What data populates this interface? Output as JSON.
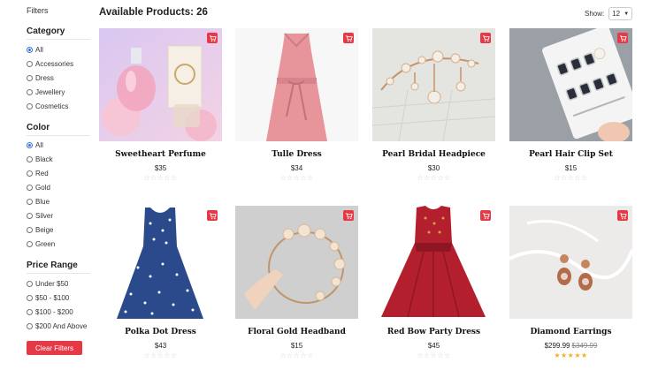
{
  "sidebar": {
    "filters_title": "Filters",
    "category": {
      "title": "Category",
      "options": [
        {
          "label": "All",
          "selected": true
        },
        {
          "label": "Accessories",
          "selected": false
        },
        {
          "label": "Dress",
          "selected": false
        },
        {
          "label": "Jewellery",
          "selected": false
        },
        {
          "label": "Cosmetics",
          "selected": false
        }
      ]
    },
    "color": {
      "title": "Color",
      "options": [
        {
          "label": "All",
          "selected": true
        },
        {
          "label": "Black",
          "selected": false
        },
        {
          "label": "Red",
          "selected": false
        },
        {
          "label": "Gold",
          "selected": false
        },
        {
          "label": "Blue",
          "selected": false
        },
        {
          "label": "Silver",
          "selected": false
        },
        {
          "label": "Beige",
          "selected": false
        },
        {
          "label": "Green",
          "selected": false
        }
      ]
    },
    "price_range": {
      "title": "Price Range",
      "options": [
        {
          "label": "Under $50",
          "selected": false
        },
        {
          "label": "$50 - $100",
          "selected": false
        },
        {
          "label": "$100 - $200",
          "selected": false
        },
        {
          "label": "$200 And Above",
          "selected": false
        }
      ]
    },
    "clear_label": "Clear Filters"
  },
  "header": {
    "title": "Available Products: 26",
    "show_label": "Show:",
    "show_value": "12"
  },
  "products": [
    {
      "name": "Sweetheart Perfume",
      "price": "$35",
      "old_price": "",
      "rating": 0,
      "icon": "perfume-image"
    },
    {
      "name": "Tulle Dress",
      "price": "$34",
      "old_price": "",
      "rating": 0,
      "icon": "pink-dress-image"
    },
    {
      "name": "Pearl Bridal Headpiece",
      "price": "$30",
      "old_price": "",
      "rating": 0,
      "icon": "headpiece-image"
    },
    {
      "name": "Pearl Hair Clip Set",
      "price": "$15",
      "old_price": "",
      "rating": 0,
      "icon": "hair-clip-image"
    },
    {
      "name": "Polka Dot Dress",
      "price": "$43",
      "old_price": "",
      "rating": 0,
      "icon": "polka-dress-image"
    },
    {
      "name": "Floral Gold Headband",
      "price": "$15",
      "old_price": "",
      "rating": 0,
      "icon": "headband-image"
    },
    {
      "name": "Red Bow Party Dress",
      "price": "$45",
      "old_price": "",
      "rating": 0,
      "icon": "red-dress-image"
    },
    {
      "name": "Diamond Earrings",
      "price": "$299.99",
      "old_price": "$349.99",
      "rating": 5,
      "icon": "earrings-image"
    }
  ],
  "colors": {
    "accent": "#e63946",
    "radio_selected": "#3b73d8",
    "star_filled": "#f2b01e",
    "star_empty": "#d3d3d3"
  }
}
